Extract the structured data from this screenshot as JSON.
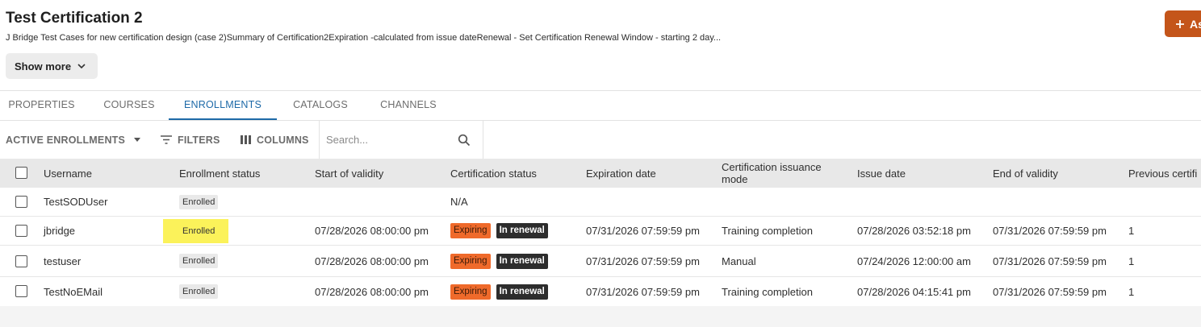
{
  "header": {
    "title": "Test Certification 2",
    "description": "J Bridge Test Cases for new certification design (case 2)Summary of Certification2Expiration -calculated from issue dateRenewal - Set Certification Renewal Window - starting 2 day...",
    "show_more_label": "Show more",
    "assign_button_label": "As"
  },
  "tabs": [
    {
      "label": "PROPERTIES"
    },
    {
      "label": "COURSES"
    },
    {
      "label": "ENROLLMENTS",
      "active": true
    },
    {
      "label": "CATALOGS"
    },
    {
      "label": "CHANNELS"
    }
  ],
  "toolbar": {
    "view_label": "ACTIVE ENROLLMENTS",
    "filters_label": "FILTERS",
    "columns_label": "COLUMNS",
    "search_placeholder": "Search..."
  },
  "table": {
    "columns": [
      "Username",
      "Enrollment status",
      "Start of validity",
      "Certification status",
      "Expiration date",
      "Certification issuance mode",
      "Issue date",
      "End of validity",
      "Previous certifi"
    ],
    "rows": [
      {
        "username": "TestSODUser",
        "enrollment_status": "Enrolled",
        "start_of_validity": "",
        "certification_status": "N/A",
        "expiring_badge": "",
        "renewal_badge": "",
        "expiration_date": "",
        "issuance_mode": "",
        "issue_date": "",
        "end_of_validity": "",
        "previous": ""
      },
      {
        "username": "jbridge",
        "enrollment_status": "Enrolled",
        "start_of_validity": "07/28/2026 08:00:00 pm",
        "certification_status": "",
        "expiring_badge": "Expiring",
        "renewal_badge": "In renewal",
        "expiration_date": "07/31/2026 07:59:59 pm",
        "issuance_mode": "Training completion",
        "issue_date": "07/28/2026 03:52:18 pm",
        "end_of_validity": "07/31/2026 07:59:59 pm",
        "previous": "1"
      },
      {
        "username": "testuser",
        "enrollment_status": "Enrolled",
        "start_of_validity": "07/28/2026 08:00:00 pm",
        "certification_status": "",
        "expiring_badge": "Expiring",
        "renewal_badge": "In renewal",
        "expiration_date": "07/31/2026 07:59:59 pm",
        "issuance_mode": "Manual",
        "issue_date": "07/24/2026 12:00:00 am",
        "end_of_validity": "07/31/2026 07:59:59 pm",
        "previous": "1"
      },
      {
        "username": "TestNoEMail",
        "enrollment_status": "Enrolled",
        "start_of_validity": "07/28/2026 08:00:00 pm",
        "certification_status": "",
        "expiring_badge": "Expiring",
        "renewal_badge": "In renewal",
        "expiration_date": "07/31/2026 07:59:59 pm",
        "issuance_mode": "Training completion",
        "issue_date": "07/28/2026 04:15:41 pm",
        "end_of_validity": "07/31/2026 07:59:59 pm",
        "previous": "1"
      }
    ]
  },
  "colors": {
    "accent": "#1e6aa8",
    "assign_button": "#c4551a",
    "expiring": "#ef6a2b",
    "renewal": "#2d2d2d",
    "highlight": "#fbf25a"
  },
  "icons": {
    "show_more": "chevron-down-icon",
    "view_dropdown": "caret-down-icon",
    "filters": "filter-icon",
    "columns": "columns-icon",
    "search": "search-icon",
    "assign": "plus-icon"
  }
}
